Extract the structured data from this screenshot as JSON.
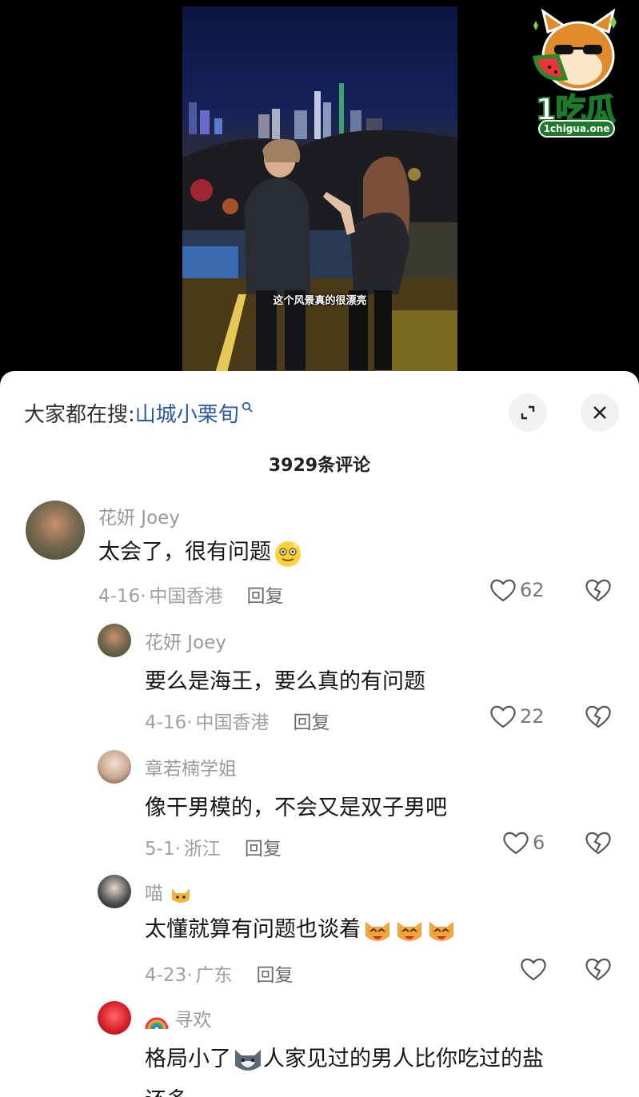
{
  "video": {
    "caption": "这个风景真的很漂亮"
  },
  "watermark": {
    "brand": "1吃瓜",
    "url": "1chigua.one"
  },
  "search": {
    "prefix": "大家都在搜:",
    "term": "山城小栗旬"
  },
  "comments_header": {
    "count_text": "3929条评论"
  },
  "comments": [
    {
      "author": "花妍 Joey",
      "text": "太会了，很有问题",
      "date": "4-16",
      "location": "中国香港",
      "reply": "回复",
      "likes": "62"
    },
    {
      "author": "花妍 Joey",
      "text": "要么是海王，要么真的有问题",
      "date": "4-16",
      "location": "中国香港",
      "reply": "回复",
      "likes": "22"
    },
    {
      "author": "章若楠学姐",
      "text": "像干男模的，不会又是双子男吧",
      "date": "5-1",
      "location": "浙江",
      "reply": "回复",
      "likes": "6"
    },
    {
      "author": "喵",
      "text": "太懂就算有问题也谈着",
      "date": "4-23",
      "location": "广东",
      "reply": "回复",
      "likes": ""
    },
    {
      "author": "寻欢",
      "text": "格局小了",
      "text2": "人家见过的男人比你吃过的盐",
      "text3": "还多",
      "date": "",
      "location": "",
      "reply": "",
      "likes": ""
    }
  ],
  "colors": {
    "accent_link": "#2b5aa3",
    "meta_gray": "#a0a0a0",
    "text_dark": "#161616"
  }
}
